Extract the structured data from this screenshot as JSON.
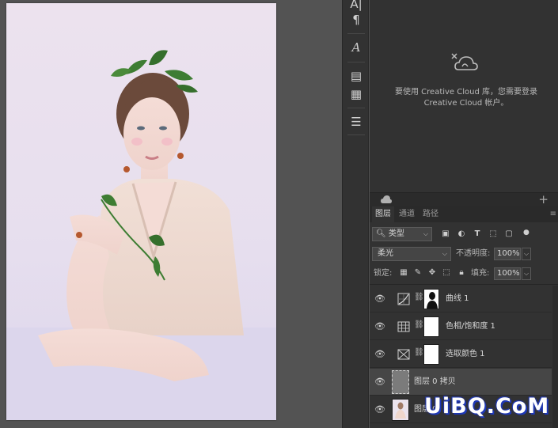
{
  "panels": {
    "cc_libraries": {
      "message": "要使用 Creative Cloud 库，您需要登录 Creative Cloud 帐户。",
      "icon": "creative-cloud-icon"
    },
    "layers": {
      "tabs": [
        {
          "label": "图层",
          "active": true
        },
        {
          "label": "通道",
          "active": false
        },
        {
          "label": "路径",
          "active": false
        }
      ],
      "filter_kind": "类型",
      "blend_mode": "柔光",
      "opacity_label": "不透明度:",
      "opacity_value": "100%",
      "lock_label": "锁定:",
      "fill_label": "填充:",
      "fill_value": "100%",
      "layers": [
        {
          "name": "曲线 1",
          "type": "curves"
        },
        {
          "name": "色相/饱和度 1",
          "type": "hue-saturation"
        },
        {
          "name": "选取颜色 1",
          "type": "selective-color"
        },
        {
          "name": "图层 0 拷贝",
          "selected": true
        },
        {
          "name": "图层 0"
        }
      ]
    }
  },
  "watermark": "UiBQ.CoM",
  "colors": {
    "panel_bg": "#323232",
    "canvas_bg": "#535353",
    "selected_layer": "#464646"
  }
}
